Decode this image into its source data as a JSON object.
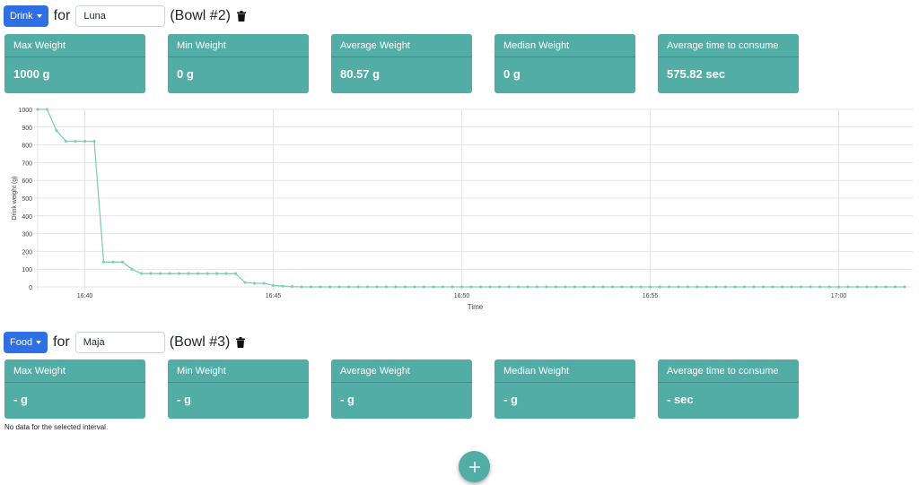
{
  "bowls": [
    {
      "type_label": "Drink",
      "for_label": "for",
      "pet_name": "Luna",
      "bowl_label": "(Bowl #2)",
      "stats": [
        {
          "label": "Max Weight",
          "value": "1000 g"
        },
        {
          "label": "Min Weight",
          "value": "0 g"
        },
        {
          "label": "Average Weight",
          "value": "80.57 g"
        },
        {
          "label": "Median Weight",
          "value": "0 g"
        },
        {
          "label": "Average time to consume",
          "value": "575.82 sec"
        }
      ]
    },
    {
      "type_label": "Food",
      "for_label": "for",
      "pet_name": "Maja",
      "bowl_label": "(Bowl #3)",
      "stats": [
        {
          "label": "Max Weight",
          "value": "- g"
        },
        {
          "label": "Min Weight",
          "value": "- g"
        },
        {
          "label": "Average Weight",
          "value": "- g"
        },
        {
          "label": "Median Weight",
          "value": "- g"
        },
        {
          "label": "Average time to consume",
          "value": "- sec"
        }
      ],
      "message": "No data for the selected interval."
    }
  ],
  "colors": {
    "card": "#52ada7",
    "line": "#7fd0b7",
    "button": "#2f6fe4"
  },
  "icons": {
    "delete": "trash-icon",
    "add": "plus-icon"
  },
  "chart_data": {
    "type": "line",
    "xlabel": "Time",
    "ylabel": "Drink weight (g)",
    "ylim": [
      0,
      1000
    ],
    "yticks": [
      0,
      100,
      200,
      300,
      400,
      500,
      600,
      700,
      800,
      900,
      1000
    ],
    "xticks": [
      "16:40",
      "16:45",
      "16:50",
      "16:55",
      "17:00"
    ],
    "x_start": "16:38:45",
    "x_step_sec": 15,
    "grid": true,
    "series": [
      {
        "values": [
          1000,
          1000,
          880,
          820,
          820,
          820,
          820,
          140,
          140,
          140,
          100,
          75,
          75,
          75,
          75,
          75,
          75,
          75,
          75,
          75,
          75,
          75,
          25,
          20,
          20,
          8,
          4,
          2,
          0,
          0,
          0,
          0,
          0,
          0,
          0,
          0,
          0,
          0,
          0,
          0,
          0,
          0,
          0,
          0,
          0,
          0,
          0,
          0,
          0,
          0,
          0,
          0,
          0,
          0,
          0,
          0,
          0,
          0,
          0,
          0,
          0,
          0,
          0,
          0,
          0,
          0,
          0,
          0,
          0,
          0,
          0,
          0,
          0,
          0,
          0,
          0,
          0,
          0,
          0,
          0,
          0,
          0,
          0,
          0,
          0,
          0,
          0,
          0,
          0,
          0,
          0,
          0,
          0,
          0,
          0,
          0,
          0,
          0
        ]
      }
    ]
  }
}
